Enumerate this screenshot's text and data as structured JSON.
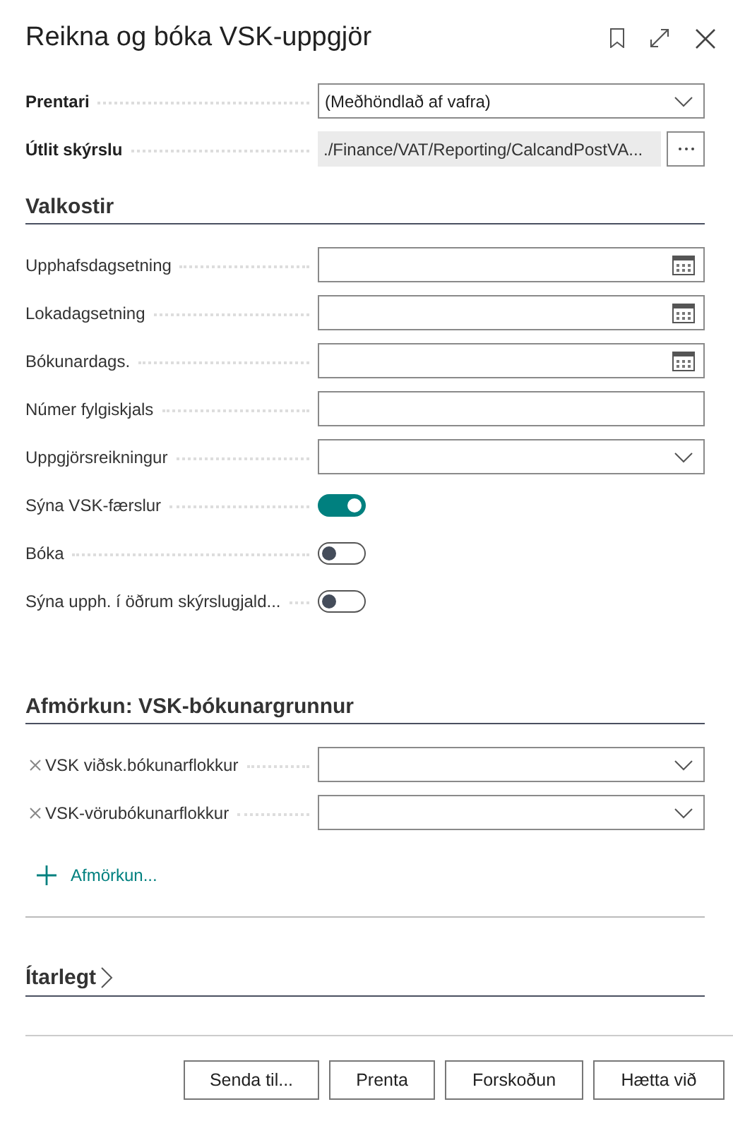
{
  "window": {
    "title": "Reikna og bóka VSK-uppgjör"
  },
  "top_fields": [
    {
      "kind": "dropdown",
      "label": "Prentari",
      "bold": true,
      "value": "(Meðhöndlað af vafra)"
    },
    {
      "kind": "path",
      "label": "Útlit skýrslu",
      "bold": true,
      "value": "./Finance/VAT/Reporting/CalcandPostVA...",
      "disabled": true
    }
  ],
  "sections": [
    {
      "title": "Valkostir",
      "fields": [
        {
          "kind": "date",
          "label": "Upphafsdagsetning"
        },
        {
          "kind": "date",
          "label": "Lokadagsetning"
        },
        {
          "kind": "date",
          "label": "Bókunardags."
        },
        {
          "kind": "text",
          "label": "Númer fylgiskjals"
        },
        {
          "kind": "dropdown",
          "label": "Uppgjörsreikningur"
        },
        {
          "kind": "toggle",
          "label": "Sýna VSK-færslur",
          "on": true
        },
        {
          "kind": "toggle",
          "label": "Bóka",
          "on": false
        },
        {
          "kind": "toggle",
          "label": "Sýna upph. í öðrum skýrslugjald...",
          "on": false
        }
      ]
    },
    {
      "title": "Afmörkun: VSK-bókunargrunnur",
      "filters": [
        {
          "kind": "dropdown",
          "label": "VSK viðsk.bókunarflokkur"
        },
        {
          "kind": "dropdown",
          "label": "VSK-vörubókunarflokkur"
        }
      ],
      "add_filter": "Afmörkun..."
    }
  ],
  "details": {
    "title": "Ítarlegt",
    "expanded": false
  },
  "buttons": [
    "Senda til...",
    "Prenta",
    "Forskoðun",
    "Hætta við"
  ]
}
